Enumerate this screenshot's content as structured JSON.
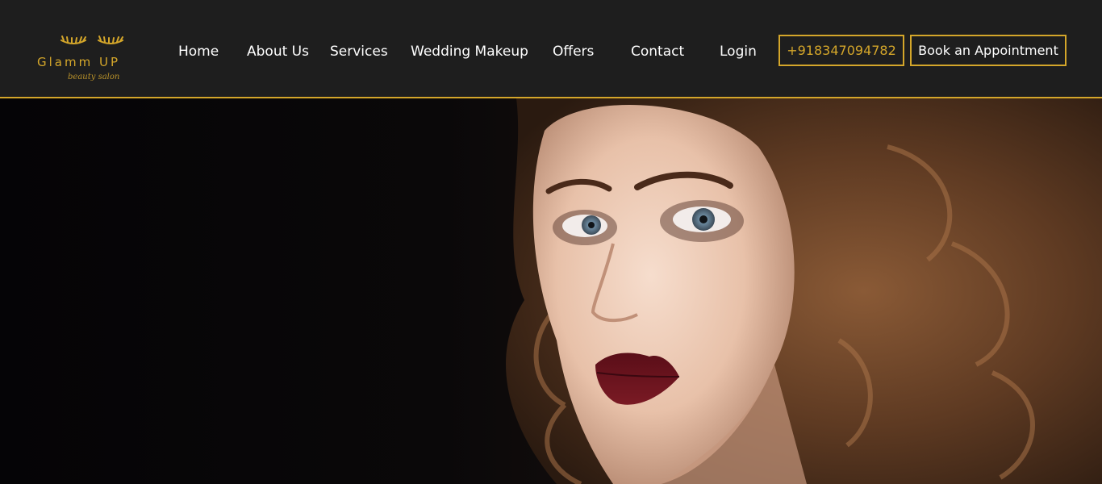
{
  "brand": {
    "name": "Glamm UP",
    "tagline": "beauty salon",
    "accent_color": "#d4a62a",
    "logo_icon": "eyelashes-icon"
  },
  "nav": {
    "items": [
      {
        "label": "Home"
      },
      {
        "label": "About Us"
      },
      {
        "label": "Services"
      },
      {
        "label": "Wedding Makeup"
      },
      {
        "label": "Offers"
      },
      {
        "label": "Contact"
      },
      {
        "label": "Login"
      }
    ],
    "phone": "+918347094782",
    "cta": "Book an Appointment"
  },
  "hero": {
    "image": "portrait of woman with auburn curly hair and dark red lipstick"
  }
}
